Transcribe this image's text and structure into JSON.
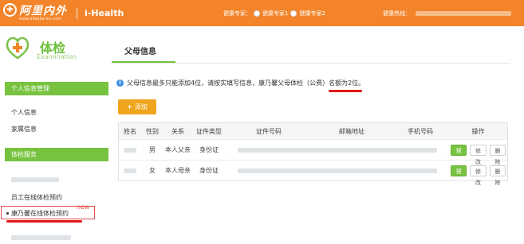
{
  "header": {
    "logo_mark": "✚",
    "logo_text": "阿里内外",
    "logo_url": "www.alibaba-inc.com",
    "brand": "i-Health",
    "experts_label": "健康专家：",
    "expert1": "健康专家1",
    "expert2": "健康专家2",
    "hotline_label": "健康热线：",
    "color": "#f3842a"
  },
  "sidebar": {
    "brand_title": "体检",
    "brand_sub": "Examination",
    "section1": "个人信息管理",
    "personal_info": "个人信息",
    "family_info": "家属信息",
    "section2": "体检服务",
    "employee_booking": "员工在线体检预约",
    "parent_booking": "康乃馨在线体检预约",
    "new_tag": "new",
    "accent": "#77c23f"
  },
  "main": {
    "title": "父母信息",
    "notice": "父母信息最多只能添加4位，请按实填写信息，康乃馨父母体检（公费）名额为2位。",
    "add_label": "添加"
  },
  "table": {
    "headers": [
      "姓名",
      "性别",
      "关系",
      "证件类型",
      "证件号码",
      "邮箱地址",
      "手机号码",
      "操作"
    ],
    "rows": [
      {
        "gender": "男",
        "relation": "本人父亲",
        "id_type": "身份证"
      },
      {
        "gender": "女",
        "relation": "本人母亲",
        "id_type": "身份证"
      }
    ],
    "actions": {
      "book": "预约",
      "edit": "修改",
      "delete": "删除"
    }
  }
}
